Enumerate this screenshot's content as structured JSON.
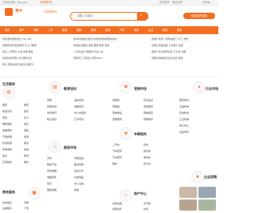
{
  "top_bar": {
    "left_text": "分类信息网 · 9zp.com",
    "switch": "【切换城市】",
    "right_links": [
      "会员登录",
      "免费注册"
    ],
    "right_extra": "手机版"
  },
  "header": {
    "logo_text": "贵中",
    "logo_sub": "【切换城市】",
    "search_placeholder": "请输入关键词",
    "publish_label": "免费发布信息"
  },
  "nav": [
    "首页",
    "房产",
    "求职",
    "二手",
    "服务",
    "宠物",
    "教育",
    "招商",
    "汽车",
    "商务",
    "生活",
    "便民",
    "更多"
  ],
  "announcements": {
    "left": [
      "免费发布便民信息 TEL:138",
      "宠物狗出售家庭繁殖 可上门看狗",
      "出售二手家具 沙发 衣柜 餐桌",
      "某某科技有限公司 招聘文员",
      "转让 旺铺 临街 位置好 面积大"
    ],
    "mid": [
      "贵中同城信息发布 免费发布各类便民信息",
      "本地生活服务 家政 维修 搬家 保洁",
      "二手房出售 精装修 拎包入住",
      "招聘普工 包吃住 月薪5000+"
    ],
    "right": [
      "[招聘] 家具厂招聘油漆工 木工 学徒",
      "[出租] 商铺出租 人流量大 临街",
      "[服务] 专业疏通管道 下水道 马桶",
      "[宠物] 纯种金毛幼犬出售 健康"
    ]
  },
  "sections": {
    "life": {
      "title": "生活服务",
      "icon": "service-icon",
      "col1": [
        "搬家",
        "保洁清洗",
        "家政",
        "维修服务",
        "电脑维修",
        "开锁换锁",
        "管道疏通",
        "家电维修",
        "送水",
        "空调移机"
      ],
      "col2": [
        "婚庆",
        "摄影",
        "礼仪",
        "鲜花",
        "酒店",
        "旅游",
        "票务",
        "快递",
        "物流",
        "租车"
      ]
    },
    "education": {
      "title": "教育培训",
      "icon": "book-icon",
      "col1": [
        "家教",
        "技能培训",
        "学历教育",
        "职业培训"
      ],
      "col2": [
        "语言培训",
        "电脑培训",
        "中小学辅导",
        "艺术培训"
      ]
    },
    "pets": {
      "title": "宠物市场",
      "icon": "paw-icon",
      "col1": [
        "宠物狗",
        "宠物猫",
        "宠物用品",
        "宠物服务"
      ],
      "col2": [
        "花鸟鱼虫",
        "宠物配种",
        "宠物医院",
        "宠物寄养"
      ]
    },
    "car": {
      "title": "车辆相关",
      "icon": "car-icon",
      "col1": [
        "二手车",
        "汽车配件",
        "汽车服务",
        "租车"
      ],
      "col2": [
        "货车",
        "摩托车",
        "电动车",
        "自行车"
      ]
    },
    "rent": {
      "title": "商务服务",
      "icon": "briefcase-icon",
      "col1": [
        "商务租赁",
        "设备租赁",
        "办公租赁",
        "装修装饰"
      ],
      "col2": [
        "印刷",
        "广告",
        "设计",
        "会计"
      ]
    },
    "goods": {
      "title": "跳蚤市场",
      "icon": "cart-icon",
      "col1": [
        "手机",
        "数码产品",
        "家用电器",
        "电脑配件",
        "家具",
        "服装鞋帽"
      ],
      "col2": [
        "母婴用品",
        "图书音像",
        "运动户外",
        "文体用品",
        "办公设备",
        "其他"
      ]
    },
    "house": {
      "title": "房产中心",
      "icon": "house-icon",
      "col1": [
        "房屋出租",
        "房屋出售",
        "商铺",
        "厂房"
      ],
      "col2": [
        "写字楼",
        "仓库",
        "土地",
        "求租"
      ]
    },
    "jobs": {
      "title": "行业市场",
      "icon": "industry-icon",
      "col1": [
        "装修建材",
        "五金机电",
        "农林牧渔",
        "工业机械",
        "电子电工",
        "食品饮料"
      ]
    },
    "hiring": {
      "title": "企业招聘",
      "icon": "hire-icon"
    }
  },
  "colors": {
    "accent": "#f36e21",
    "text": "#333333",
    "muted": "#888888"
  }
}
